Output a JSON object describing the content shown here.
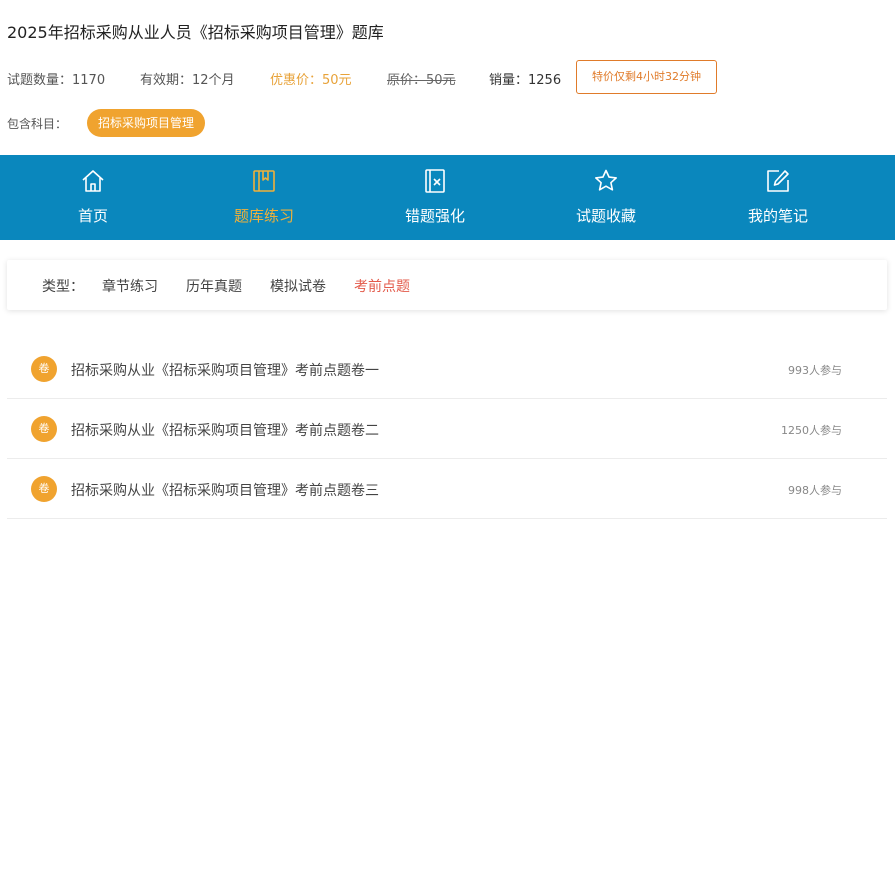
{
  "header": {
    "title": "2025年招标采购从业人员《招标采购项目管理》题库"
  },
  "meta": {
    "question_count": "试题数量：1170",
    "validity": "有效期：12个月",
    "discount_price": "优惠价：50元",
    "original_price": "原价：50元",
    "sales": "销量：1256",
    "countdown": "特价仅剩4小时32分钟"
  },
  "subjects": {
    "label": "包含科目：",
    "items": [
      "招标采购项目管理"
    ]
  },
  "nav": {
    "items": [
      {
        "label": "首页",
        "icon": "home-icon"
      },
      {
        "label": "题库练习",
        "icon": "book-icon",
        "active": true
      },
      {
        "label": "错题强化",
        "icon": "wrong-question-icon"
      },
      {
        "label": "试题收藏",
        "icon": "star-icon"
      },
      {
        "label": "我的笔记",
        "icon": "edit-note-icon"
      }
    ]
  },
  "types": {
    "label": "类型：",
    "tabs": [
      "章节练习",
      "历年真题",
      "模拟试卷",
      "考前点题"
    ],
    "active": "考前点题"
  },
  "papers": {
    "badge": "卷",
    "rows": [
      {
        "title": "招标采购从业《招标采购项目管理》考前点题卷一",
        "count": "993人参与"
      },
      {
        "title": "招标采购从业《招标采购项目管理》考前点题卷二",
        "count": "1250人参与"
      },
      {
        "title": "招标采购从业《招标采购项目管理》考前点题卷三",
        "count": "998人参与"
      }
    ]
  },
  "colors": {
    "nav_bg": "#0a87bd",
    "accent_orange": "#f0a32f",
    "active_tab_red": "#e35b4b"
  }
}
